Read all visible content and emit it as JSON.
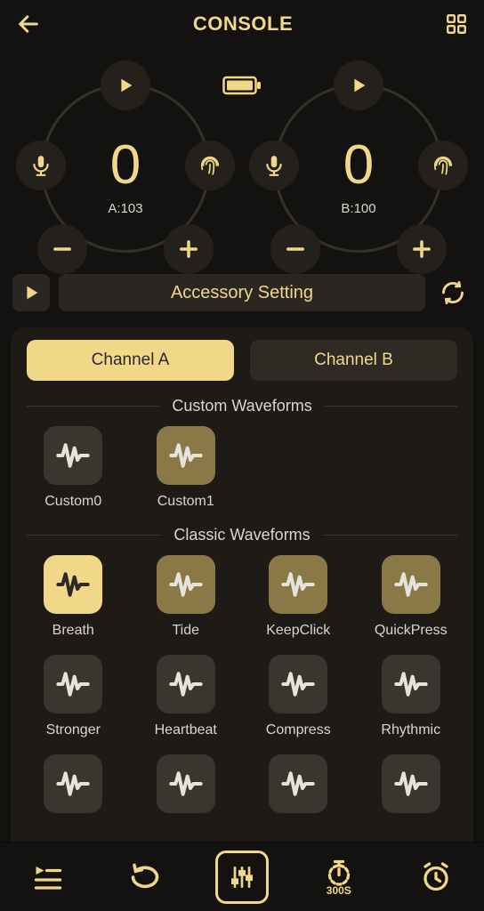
{
  "header": {
    "title": "CONSOLE"
  },
  "channels": {
    "a": {
      "value": "0",
      "label": "A:103"
    },
    "b": {
      "value": "0",
      "label": "B:100"
    }
  },
  "accessory": {
    "label": "Accessory Setting"
  },
  "tabs": {
    "a": "Channel A",
    "b": "Channel B"
  },
  "sections": {
    "custom": "Custom Waveforms",
    "classic": "Classic Waveforms"
  },
  "custom": [
    {
      "label": "Custom0",
      "style": "default"
    },
    {
      "label": "Custom1",
      "style": "olive"
    }
  ],
  "classic": [
    {
      "label": "Breath",
      "style": "accent"
    },
    {
      "label": "Tide",
      "style": "olive"
    },
    {
      "label": "KeepClick",
      "style": "olive"
    },
    {
      "label": "QuickPress",
      "style": "olive"
    },
    {
      "label": "Stronger",
      "style": "default"
    },
    {
      "label": "Heartbeat",
      "style": "default"
    },
    {
      "label": "Compress",
      "style": "default"
    },
    {
      "label": "Rhythmic",
      "style": "default"
    },
    {
      "label": "",
      "style": "default"
    },
    {
      "label": "",
      "style": "default"
    },
    {
      "label": "",
      "style": "default"
    },
    {
      "label": "",
      "style": "default"
    }
  ],
  "timer": {
    "label": "300S"
  }
}
